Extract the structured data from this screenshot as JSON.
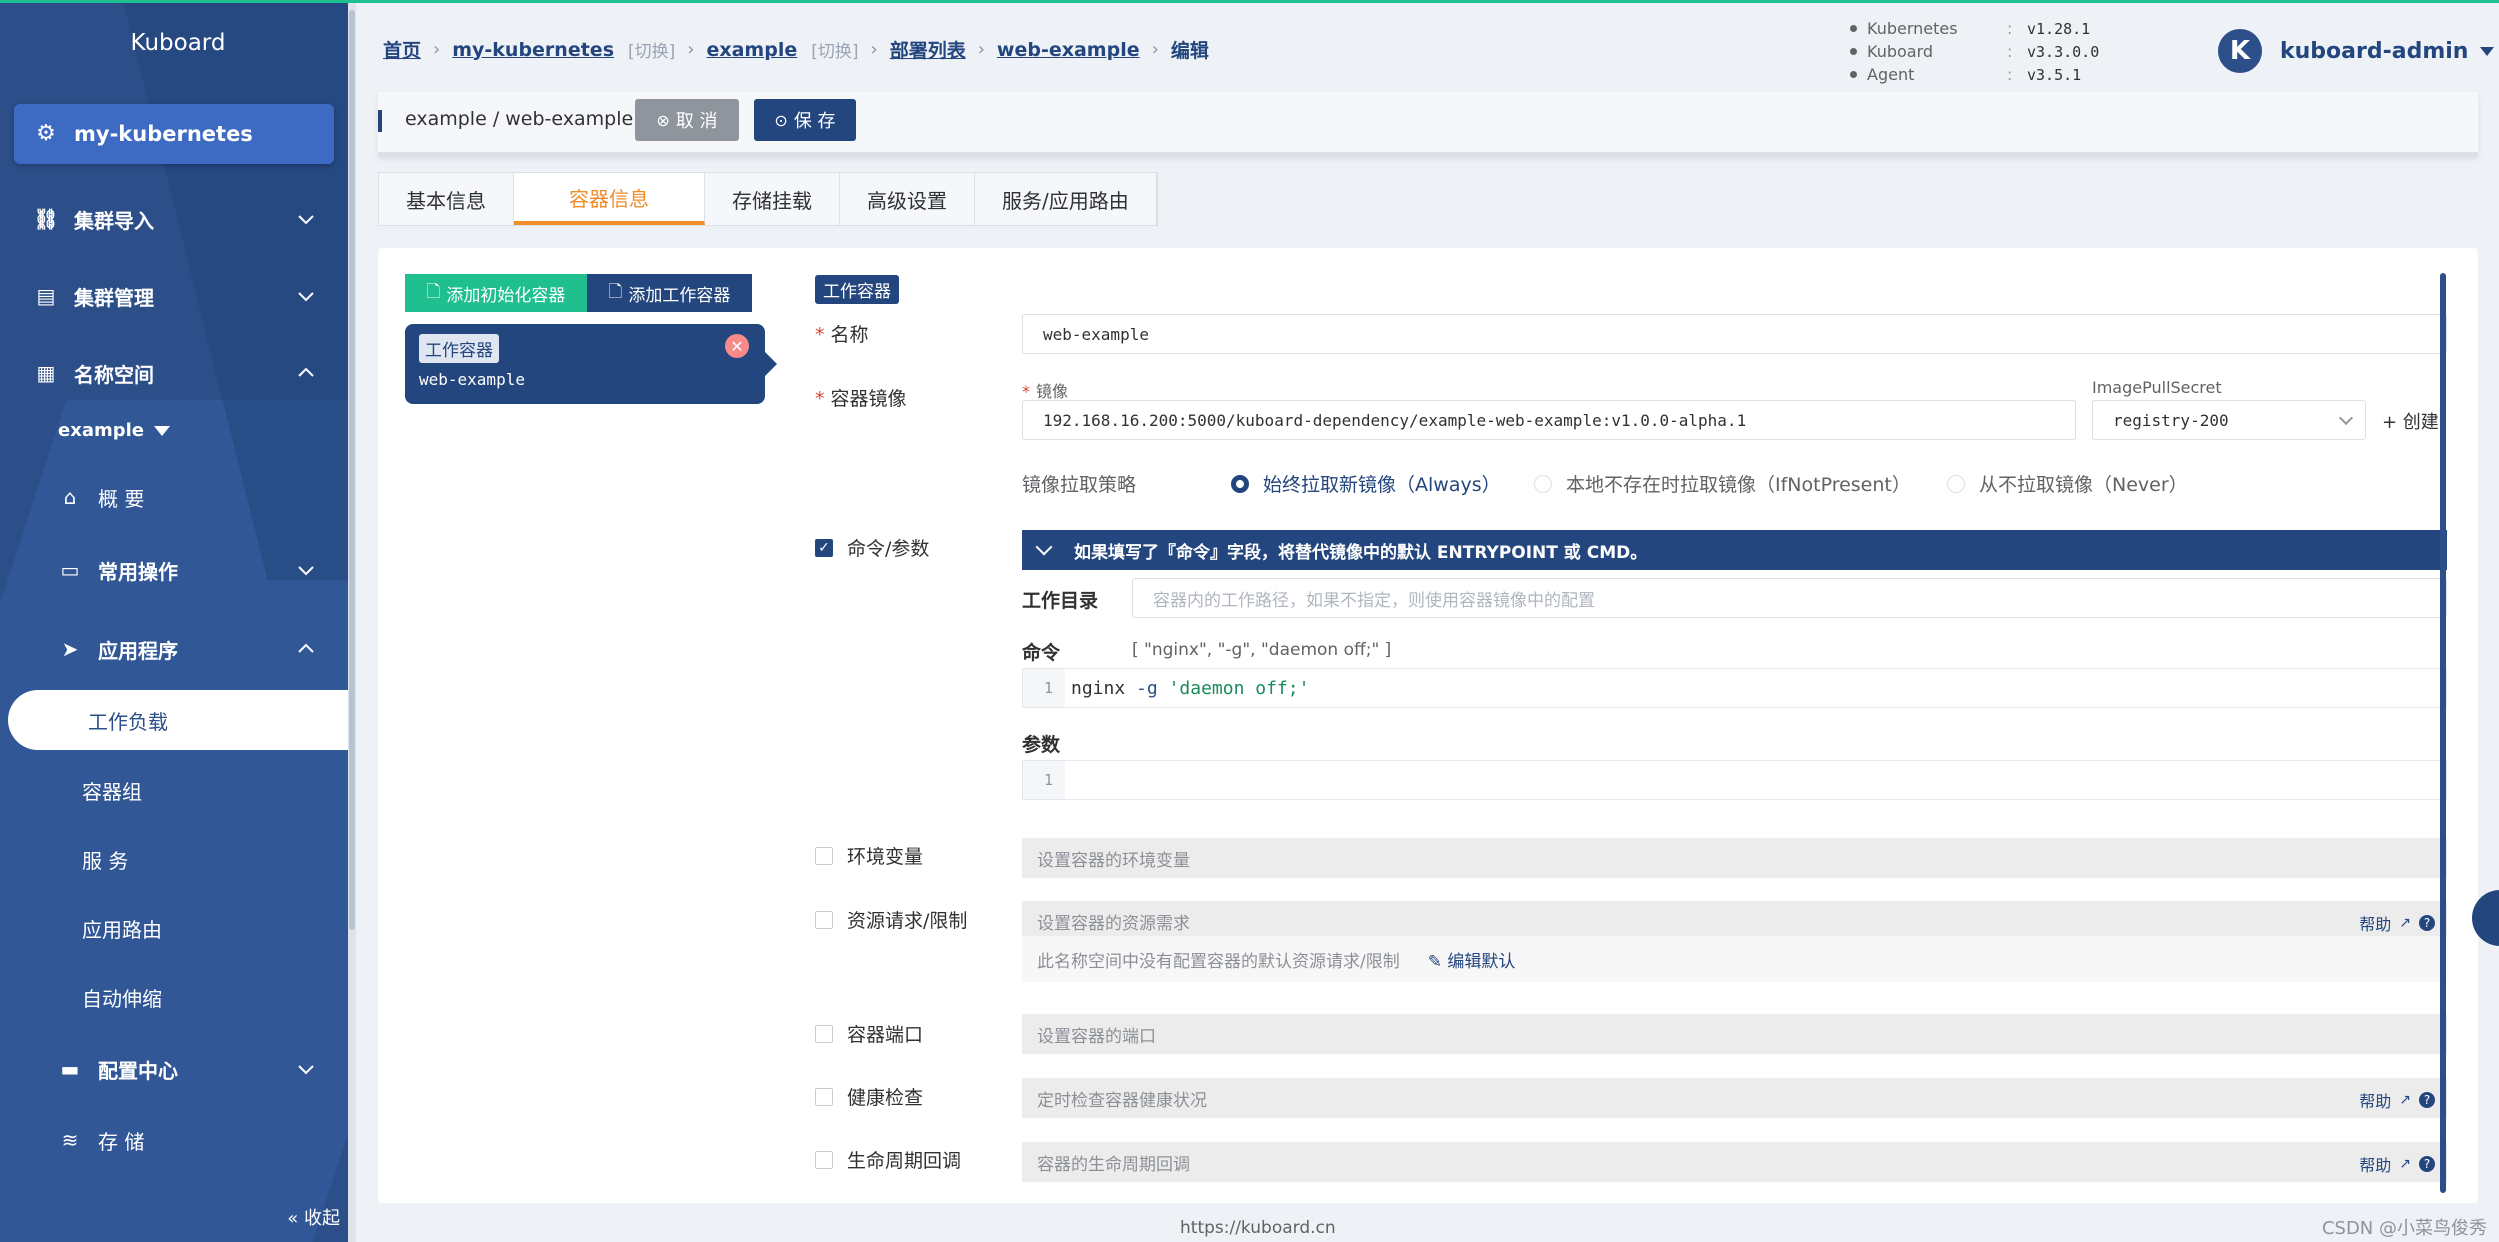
{
  "sidebar": {
    "brand": "Kuboard",
    "cluster": "my-kubernetes",
    "items": [
      {
        "label": "集群导入",
        "icon": "link-icon"
      },
      {
        "label": "集群管理",
        "icon": "server-icon"
      },
      {
        "label": "名称空间",
        "icon": "grid-icon"
      }
    ],
    "namespace": "example",
    "overview": "概 要",
    "common_ops": "常用操作",
    "apps": "应用程序",
    "apps_items": [
      "工作负载",
      "容器组",
      "服 务",
      "应用路由",
      "自动伸缩"
    ],
    "config_center": "配置中心",
    "storage": "存 储",
    "collapse": "« 收起"
  },
  "header": {
    "breadcrumbs": {
      "home": "首页",
      "cluster": "my-kubernetes",
      "switch1": "[切换]",
      "namespace": "example",
      "switch2": "[切换]",
      "deployments": "部署列表",
      "workload": "web-example",
      "current": "编辑"
    },
    "versions": [
      {
        "name": "Kubernetes",
        "value": "v1.28.1"
      },
      {
        "name": "Kuboard",
        "value": "v3.3.0.0"
      },
      {
        "name": "Agent",
        "value": "v3.5.1"
      }
    ],
    "user": {
      "initial": "K",
      "name": "kuboard-admin"
    }
  },
  "titlebar": {
    "title": "example / web-example",
    "cancel": "取 消",
    "save": "保 存"
  },
  "tabs": [
    "基本信息",
    "容器信息",
    "存储挂载",
    "高级设置",
    "服务/应用路由"
  ],
  "active_tab": "容器信息",
  "containers": {
    "add_init": "添加初始化容器",
    "add_work": "添加工作容器",
    "card_tag": "工作容器",
    "card_name": "web-example"
  },
  "form": {
    "section_tag": "工作容器",
    "name_label": "名称",
    "name_value": "web-example",
    "image_label": "容器镜像",
    "image_sub_label": "镜像",
    "image_value": "192.168.16.200:5000/kuboard-dependency/example-web-example:v1.0.0-alpha.1",
    "pull_secret_label": "ImagePullSecret",
    "pull_secret_value": "registry-200",
    "create_label": "+ 创建",
    "pull_policy_label": "镜像拉取策略",
    "pull_policy_options": [
      "始终拉取新镜像（Always）",
      "本地不存在时拉取镜像（IfNotPresent）",
      "从不拉取镜像（Never）"
    ],
    "pull_policy_selected": "始终拉取新镜像（Always）",
    "cmd_checkbox": "命令/参数",
    "cmd_checked": true,
    "cmd_banner": "如果填写了『命令』字段，将替代镜像中的默认 ENTRYPOINT 或 CMD。",
    "workdir_label": "工作目录",
    "workdir_placeholder": "容器内的工作路径，如果不指定，则使用容器镜像中的配置",
    "command_label": "命令",
    "command_hint": "[ \"nginx\", \"-g\", \"daemon off;\" ]",
    "command_line_no": "1",
    "command_code": {
      "cmd": "nginx",
      "flag": "-g",
      "str": "'daemon off;'"
    },
    "args_label": "参数",
    "args_line_no": "1",
    "env_label": "环境变量",
    "env_placeholder": "设置容器的环境变量",
    "resources_label": "资源请求/限制",
    "resources_placeholder": "设置容器的资源需求",
    "resources_note": "此名称空间中没有配置容器的默认资源请求/限制",
    "resources_edit": "编辑默认",
    "ports_label": "容器端口",
    "ports_placeholder": "设置容器的端口",
    "health_label": "健康检查",
    "health_placeholder": "定时检查容器健康状况",
    "lifecycle_label": "生命周期回调",
    "lifecycle_placeholder": "容器的生命周期回调",
    "help": "帮助"
  },
  "footer": {
    "url": "https://kuboard.cn",
    "watermark": "CSDN @小菜鸟俊秀"
  },
  "colors": {
    "primary": "#24467e",
    "accent": "#1fbf8f",
    "active_tab": "#f08c2a"
  }
}
